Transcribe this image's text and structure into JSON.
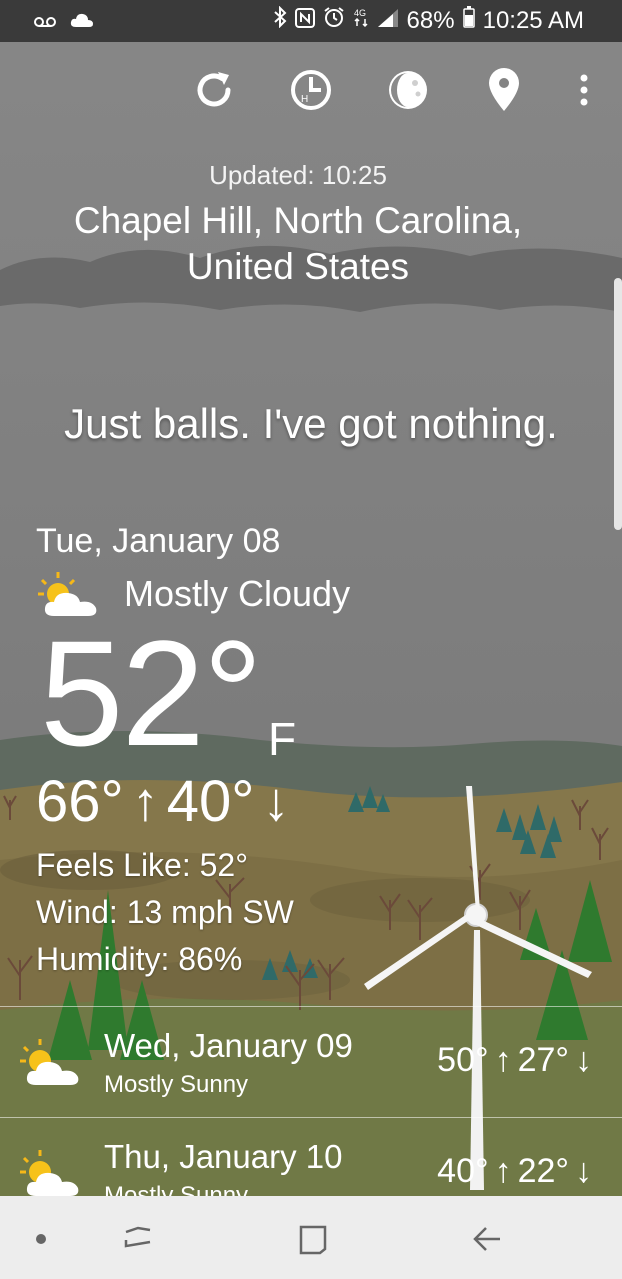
{
  "status_bar": {
    "battery": "68%",
    "time": "10:25 AM",
    "icons": [
      "voicemail-icon",
      "cloud-icon",
      "bluetooth-icon",
      "nfc-icon",
      "alarm-icon",
      "data-4g-icon",
      "signal-icon",
      "battery-icon"
    ]
  },
  "toolbar": {
    "actions": [
      "refresh-icon",
      "history-icon",
      "moon-phase-icon",
      "location-pin-icon",
      "more-vert-icon"
    ]
  },
  "header": {
    "updated": "Updated: 10:25",
    "location_line1": "Chapel Hill, North Carolina,",
    "location_line2": "United States"
  },
  "tagline": "Just balls. I've got nothing.",
  "current": {
    "date": "Tue, January 08",
    "condition": "Mostly Cloudy",
    "temp": "52°",
    "unit": "F",
    "high": "66°",
    "low": "40°",
    "feels_like": "Feels Like: 52°",
    "wind": "Wind: 13 mph SW",
    "humidity": "Humidity: 86%"
  },
  "forecast": [
    {
      "day": "Wed, January 09",
      "condition": "Mostly Sunny",
      "high": "50°",
      "low": "27°"
    },
    {
      "day": "Thu, January 10",
      "condition": "Mostly Sunny",
      "high": "40°",
      "low": "22°"
    }
  ],
  "nav_bar": {
    "buttons": [
      "dot-icon",
      "recent-apps-icon",
      "home-icon",
      "back-icon"
    ]
  },
  "colors": {
    "sky": "#7d7d7d",
    "hills": "#8a7b4d",
    "status_bar": "#3a3a3a",
    "nav_bar": "#ededed"
  }
}
